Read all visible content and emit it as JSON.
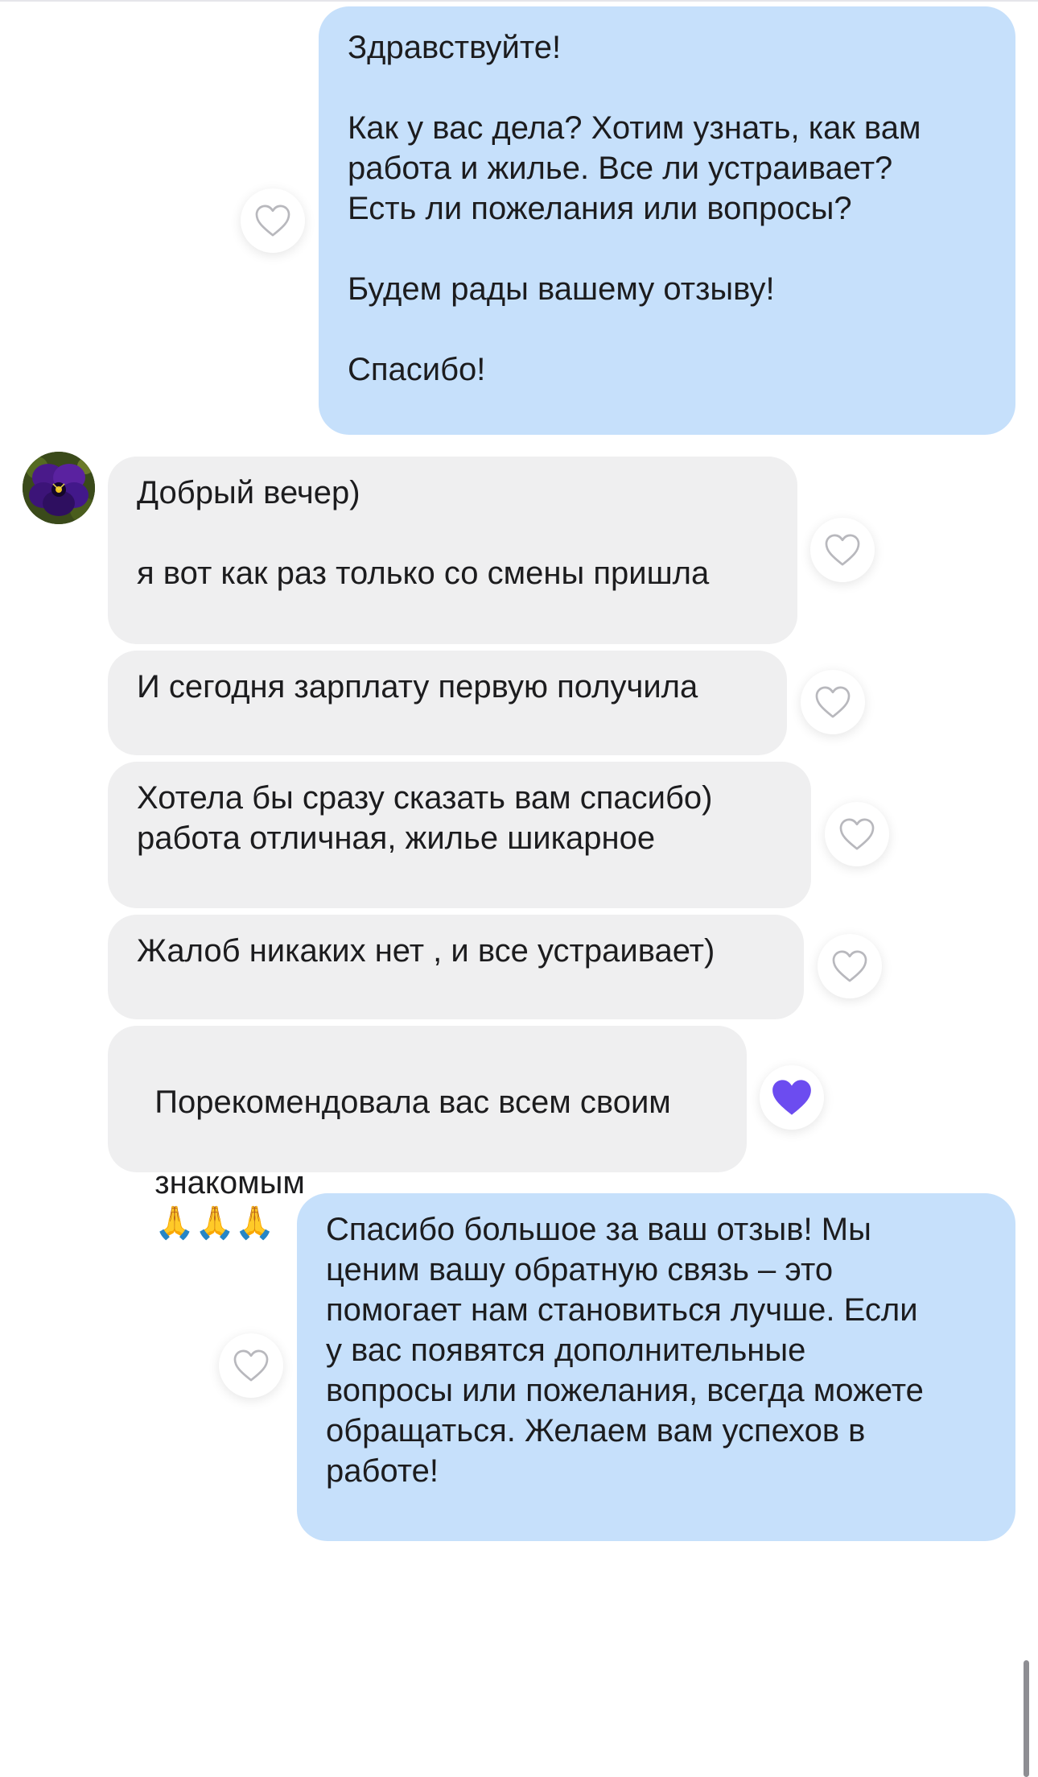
{
  "colors": {
    "outgoing_bubble": "#c6e0fb",
    "incoming_bubble": "#efeff0",
    "liked_heart": "#6c4cf0",
    "empty_heart_stroke": "#b8b8bd"
  },
  "messages": [
    {
      "id": "m1",
      "direction": "outgoing",
      "text": "Здравствуйте!\n\nКак у вас дела? Хотим узнать, как вам\nработа и жилье. Все ли устраивает?\nЕсть ли пожелания или вопросы?\n\nБудем рады вашему отзыву!\n\nСпасибо!",
      "liked": false,
      "icon": "heart-outline-icon"
    },
    {
      "id": "m2",
      "direction": "incoming",
      "text": "Добрый вечер)\n\nя вот как раз только со смены пришла",
      "liked": false,
      "icon": "heart-outline-icon"
    },
    {
      "id": "m3",
      "direction": "incoming",
      "text": "И сегодня зарплату первую получила",
      "liked": false,
      "icon": "heart-outline-icon"
    },
    {
      "id": "m4",
      "direction": "incoming",
      "text": "Хотела бы сразу сказать вам спасибо)\nработа отличная, жилье шикарное",
      "liked": false,
      "icon": "heart-outline-icon"
    },
    {
      "id": "m5",
      "direction": "incoming",
      "text": "Жалоб никаких нет , и все устраивает)",
      "liked": false,
      "icon": "heart-outline-icon"
    },
    {
      "id": "m6",
      "direction": "incoming",
      "text_line1": "Порекомендовала вас всем своим",
      "text_line2": "знакомым",
      "emoji": "🙏🙏🙏",
      "emoji_icon": "folded-hands-emoji",
      "liked": true,
      "icon": "heart-filled-icon"
    },
    {
      "id": "m7",
      "direction": "outgoing",
      "text": "Спасибо большое за ваш отзыв! Мы\nценим вашу обратную связь – это\nпомогает нам становиться лучше. Если\nу вас появятся дополнительные\nвопросы или пожелания, всегда можете\nобращаться. Желаем вам успехов в\nработе!",
      "liked": false,
      "icon": "heart-outline-icon"
    }
  ],
  "sender_avatar": {
    "icon": "pansy-flower-avatar"
  }
}
